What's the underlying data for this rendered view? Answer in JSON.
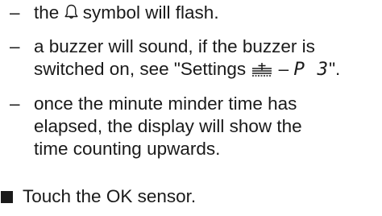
{
  "items": [
    {
      "dash": "–",
      "line1_prefix": "the ",
      "icon": "bell-icon",
      "line1_suffix": " symbol will flash."
    },
    {
      "dash": "–",
      "line1": "a buzzer will sound, if the buzzer is",
      "line2_prefix": "switched on, see \"Settings ",
      "icon": "settings-symbol-icon",
      "line2_mid": " – ",
      "code": "P 3",
      "line2_suffix": "\"."
    },
    {
      "dash": "–",
      "line1": "once the minute minder time has",
      "line2": "elapsed, the display will show the",
      "line3": "time counting upwards."
    }
  ],
  "instruction": {
    "bullet": "square-bullet",
    "text": "Touch the OK sensor."
  }
}
